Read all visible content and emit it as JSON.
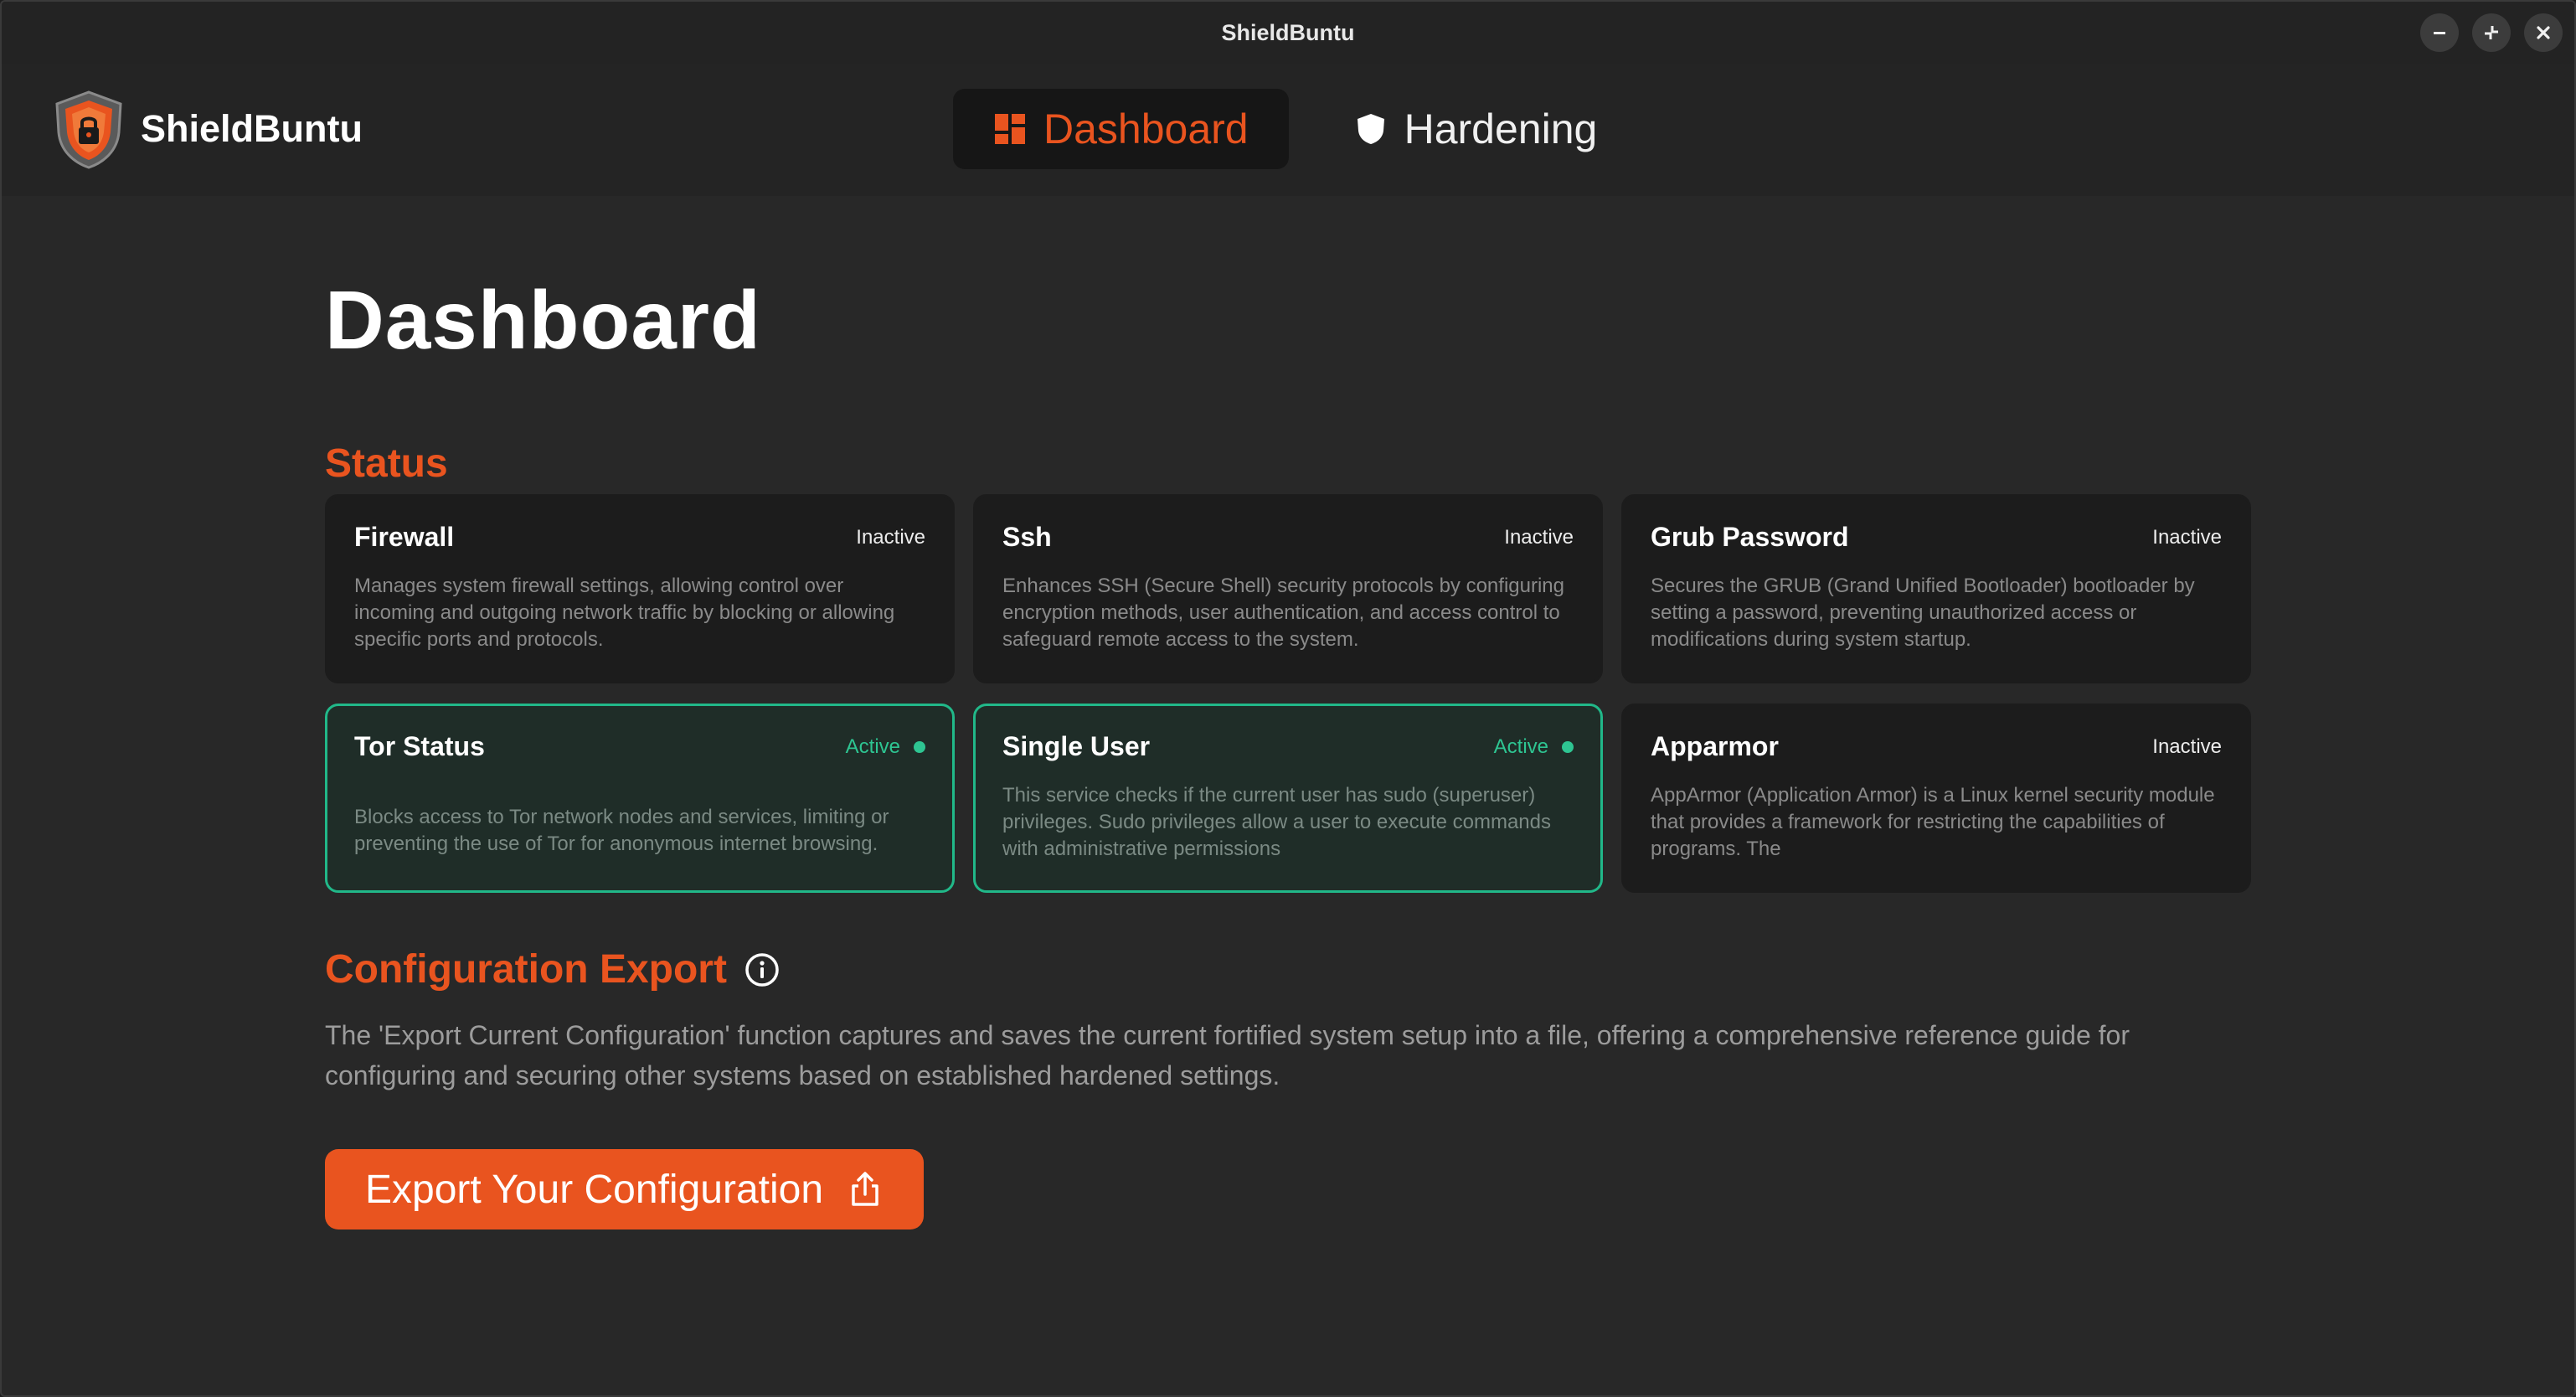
{
  "window": {
    "title": "ShieldBuntu"
  },
  "window_controls": {
    "minimize": "−",
    "restore": "↙",
    "close": "✕"
  },
  "brand": {
    "name": "ShieldBuntu",
    "logo_icon": "shield-lock-logo"
  },
  "nav": [
    {
      "label": "Dashboard",
      "icon": "grid-icon",
      "active": true
    },
    {
      "label": "Hardening",
      "icon": "shield-icon",
      "active": false
    }
  ],
  "main": {
    "title": "Dashboard",
    "status_section_title": "Status",
    "cards": [
      {
        "title": "Firewall",
        "status": "Inactive",
        "active": false,
        "description": "Manages system firewall settings, allowing control over incoming and outgoing network traffic by blocking or allowing specific ports and protocols."
      },
      {
        "title": "Ssh",
        "status": "Inactive",
        "active": false,
        "description": "Enhances SSH (Secure Shell) security protocols by configuring encryption methods, user authentication, and access control to safeguard remote access to the system."
      },
      {
        "title": "Grub Password",
        "status": "Inactive",
        "active": false,
        "description": "Secures the GRUB (Grand Unified Bootloader) bootloader by setting a password, preventing unauthorized access or modifications during system startup."
      },
      {
        "title": "Tor Status",
        "status": "Active",
        "active": true,
        "description": "Blocks access to Tor network nodes and services, limiting or preventing the use of Tor for anonymous internet browsing."
      },
      {
        "title": "Single User",
        "status": "Active",
        "active": true,
        "description": "This service checks if the current user has sudo (superuser) privileges. Sudo privileges allow a user to execute commands with administrative permissions"
      },
      {
        "title": "Apparmor",
        "status": "Inactive",
        "active": false,
        "description": "AppArmor (Application Armor) is a Linux kernel security module that provides a framework for restricting the capabilities of programs. The"
      }
    ],
    "export": {
      "title": "Configuration Export",
      "description": "The 'Export Current Configuration' function captures and saves the current fortified system setup into a file, offering a comprehensive reference guide for configuring and securing other systems based on established hardened settings.",
      "button_label": "Export Your Configuration"
    }
  },
  "colors": {
    "accent": "#e9541f",
    "active_green": "#21b889",
    "background": "#282828",
    "card_background": "#1c1c1c"
  }
}
